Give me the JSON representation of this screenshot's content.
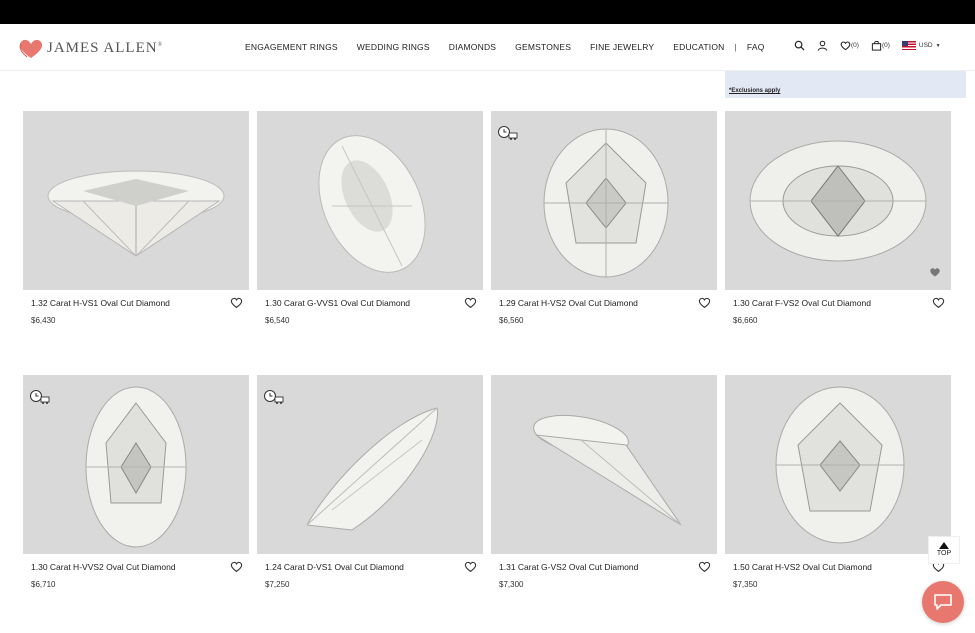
{
  "brand": {
    "name": "JAMES ALLEN",
    "reg": "®"
  },
  "nav": [
    "ENGAGEMENT RINGS",
    "WEDDING RINGS",
    "DIAMONDS",
    "GEMSTONES",
    "FINE JEWELRY",
    "EDUCATION",
    "FAQ"
  ],
  "nav_separator": "|",
  "header_icons": {
    "wishlist_count": "(0)",
    "cart_count": "(0)",
    "currency": "USD"
  },
  "promo": {
    "link": "*Exclusions apply"
  },
  "products": [
    {
      "title": "1.32 Carat H-VS1 Oval Cut Diamond",
      "price": "$6,430"
    },
    {
      "title": "1.30 Carat G-VVS1 Oval Cut Diamond",
      "price": "$6,540"
    },
    {
      "title": "1.29 Carat H-VS2 Oval Cut Diamond",
      "price": "$6,560"
    },
    {
      "title": "1.30 Carat F-VS2 Oval Cut Diamond",
      "price": "$6,660"
    },
    {
      "title": "1.30 Carat H-VVS2 Oval Cut Diamond",
      "price": "$6,710"
    },
    {
      "title": "1.24 Carat D-VS1 Oval Cut Diamond",
      "price": "$7,250"
    },
    {
      "title": "1.31 Carat G-VS2 Oval Cut Diamond",
      "price": "$7,300"
    },
    {
      "title": "1.50 Carat H-VS2 Oval Cut Diamond",
      "price": "$7,350"
    }
  ],
  "top_button": {
    "label": "TOP"
  },
  "colors": {
    "accent": "#e8786f",
    "promo_bg": "#e3e8f5",
    "image_bg": "#d9d9d9"
  }
}
